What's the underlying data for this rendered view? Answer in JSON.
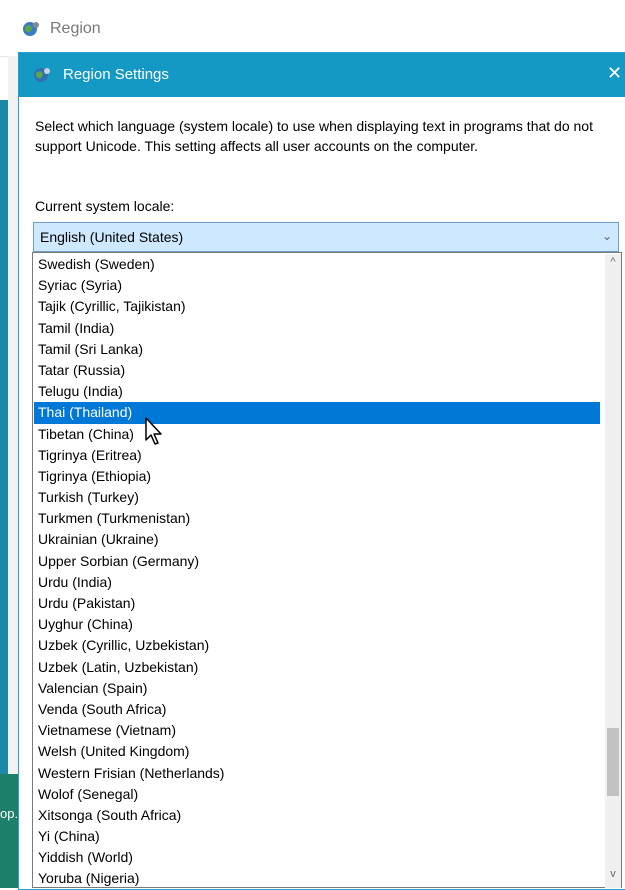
{
  "outer_window": {
    "title": "Region",
    "left_text": "op."
  },
  "dialog": {
    "title": "Region Settings",
    "close_glyph": "✕",
    "description": "Select which language (system locale) to use when displaying text in programs that do not support Unicode. This setting affects all user accounts on the computer.",
    "locale_label": "Current system locale:",
    "locale_value": "English (United States)",
    "chevron": "⌄"
  },
  "dropdown": {
    "selected_index": 7,
    "items": [
      "Swedish (Sweden)",
      "Syriac (Syria)",
      "Tajik (Cyrillic, Tajikistan)",
      "Tamil (India)",
      "Tamil (Sri Lanka)",
      "Tatar (Russia)",
      "Telugu (India)",
      "Thai (Thailand)",
      "Tibetan (China)",
      "Tigrinya (Eritrea)",
      "Tigrinya (Ethiopia)",
      "Turkish (Turkey)",
      "Turkmen (Turkmenistan)",
      "Ukrainian (Ukraine)",
      "Upper Sorbian (Germany)",
      "Urdu (India)",
      "Urdu (Pakistan)",
      "Uyghur (China)",
      "Uzbek (Cyrillic, Uzbekistan)",
      "Uzbek (Latin, Uzbekistan)",
      "Valencian (Spain)",
      "Venda (South Africa)",
      "Vietnamese (Vietnam)",
      "Welsh (United Kingdom)",
      "Western Frisian (Netherlands)",
      "Wolof (Senegal)",
      "Xitsonga (South Africa)",
      "Yi (China)",
      "Yiddish (World)",
      "Yoruba (Nigeria)"
    ],
    "scroll_up_glyph": "^",
    "scroll_down_glyph": "v",
    "scroll_position": 0.86
  },
  "colors": {
    "dialog_titlebar": "#1499c4",
    "selected_item": "#0078d7",
    "select_box": "#cde8ff"
  }
}
